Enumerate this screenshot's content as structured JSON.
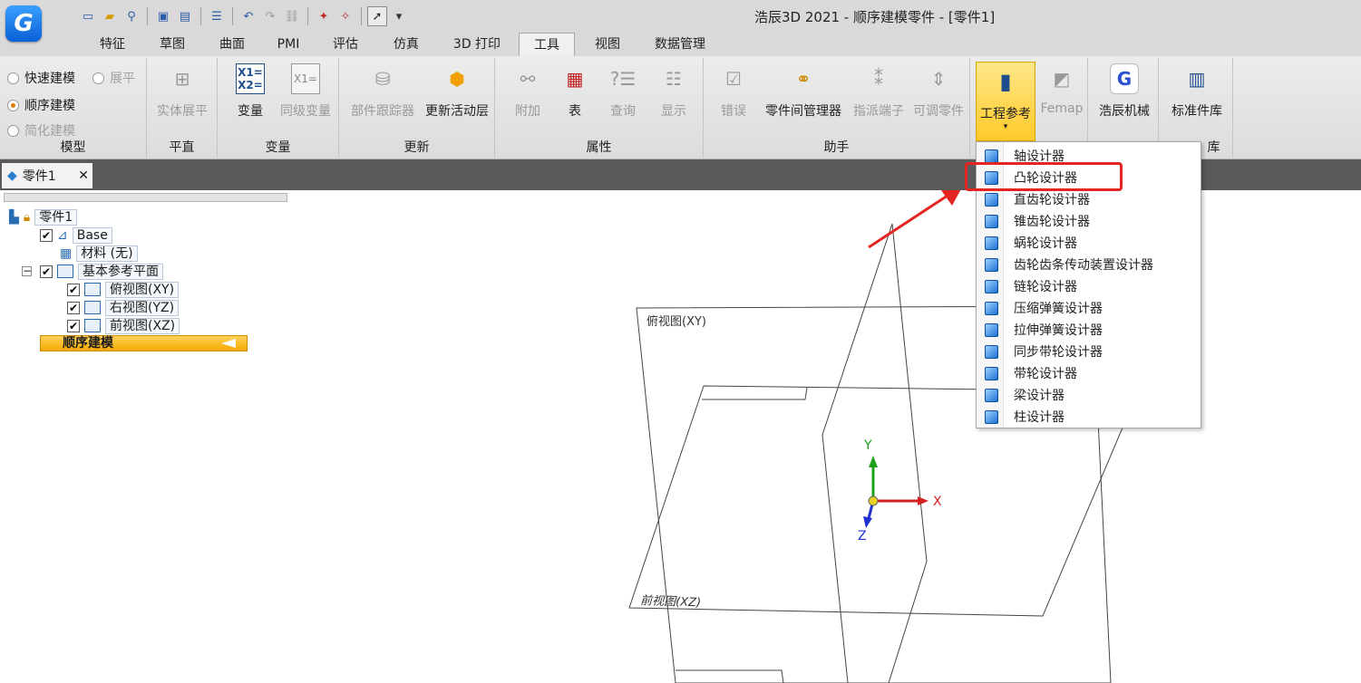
{
  "window_title": "浩辰3D 2021 - 顺序建模零件 - [零件1]",
  "logo_letter": "G",
  "quick_access": [
    "new-icon",
    "open-icon",
    "zoom-icon",
    "save-icon",
    "saveas-icon",
    "properties-icon",
    "undo-icon",
    "redo-icon",
    "link-icon",
    "select-icon"
  ],
  "tabs": [
    "特征",
    "草图",
    "曲面",
    "PMI",
    "评估",
    "仿真",
    "3D 打印",
    "工具",
    "视图",
    "数据管理"
  ],
  "active_tab": "工具",
  "ribbon": {
    "model": {
      "options": [
        "快速建模",
        "展平",
        "顺序建模",
        "简化建模"
      ],
      "label": "模型"
    },
    "flat": {
      "buttons": [
        "实体展平"
      ],
      "label": "平直"
    },
    "variables": {
      "buttons": [
        "变量",
        "同级变量"
      ],
      "label": "变量"
    },
    "update": {
      "buttons": [
        "部件跟踪器",
        "更新活动层"
      ],
      "label": "更新"
    },
    "props": {
      "buttons": [
        "附加",
        "表",
        "查询",
        "显示"
      ],
      "label": "属性"
    },
    "assist": {
      "buttons": [
        "错误",
        "零件间管理器",
        "指派端子",
        "可调零件"
      ],
      "label": "助手"
    },
    "eng": {
      "buttons": [
        "工程参考",
        "Femap"
      ]
    },
    "gc": {
      "buttons": [
        "浩辰机械"
      ]
    },
    "std": {
      "buttons": [
        "标准件库"
      ],
      "label": "库"
    }
  },
  "doc_tab": {
    "title": "零件1",
    "close": "✕"
  },
  "tree": {
    "root": "零件1",
    "base": "Base",
    "material": "材料 (无)",
    "refplanes": "基本参考平面",
    "top": "俯视图(XY)",
    "right": "右视图(YZ)",
    "front": "前视图(XZ)",
    "sequential": "顺序建模"
  },
  "viewport": {
    "plane_xy": "俯视图(XY)",
    "plane_xz": "前视图(XZ)",
    "axis_x": "X",
    "axis_y": "Y",
    "axis_z": "Z"
  },
  "menu": {
    "items": [
      "轴设计器",
      "凸轮设计器",
      "直齿轮设计器",
      "锥齿轮设计器",
      "蜗轮设计器",
      "齿轮齿条传动装置设计器",
      "链轮设计器",
      "压缩弹簧设计器",
      "拉伸弹簧设计器",
      "同步带轮设计器",
      "带轮设计器",
      "梁设计器",
      "柱设计器"
    ],
    "highlighted": "凸轮设计器"
  },
  "colors": {
    "accent": "#e52521",
    "active_button": "#ffc928",
    "sequential": "#f5a800"
  }
}
